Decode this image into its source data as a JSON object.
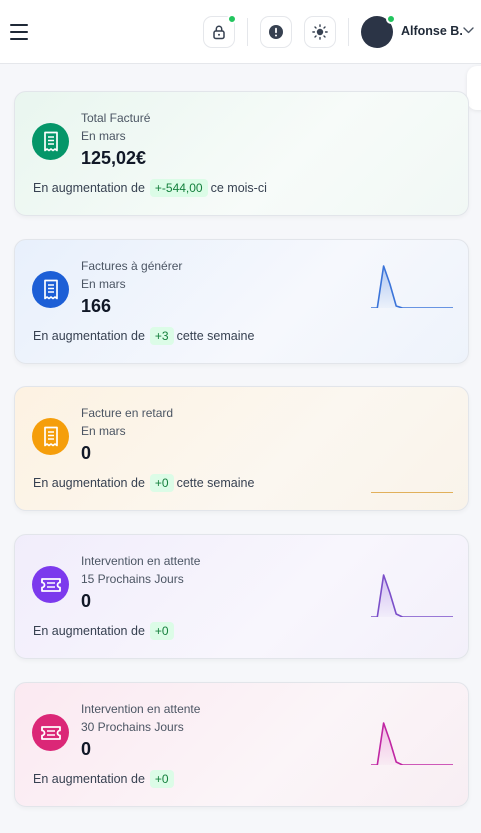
{
  "header": {
    "user_name": "Alfonse B.",
    "icons": [
      "menu-icon",
      "lock-icon",
      "alert-icon",
      "sun-icon",
      "avatar",
      "chevron-down-icon"
    ],
    "status_color": "#22c55e"
  },
  "cards": [
    {
      "title": "Total Facturé",
      "subtitle": "En mars",
      "value": "125,02€",
      "footer_prefix": "En augmentation de",
      "delta": "+-544,00",
      "footer_suffix": "ce mois-ci",
      "icon": "receipt-icon",
      "accent": "#059669",
      "sparkline": null
    },
    {
      "title": "Factures à générer",
      "subtitle": "En mars",
      "value": "166",
      "footer_prefix": "En augmentation de",
      "delta": "+3",
      "footer_suffix": "cette semaine",
      "icon": "receipt-icon",
      "accent": "#1d5fd6",
      "sparkline": {
        "color": "#3b74d9",
        "fill": "#a9c3f0",
        "values": [
          0,
          0,
          42,
          24,
          2,
          0,
          0,
          0,
          0,
          0,
          0,
          0,
          0,
          0
        ]
      }
    },
    {
      "title": "Facture en retard",
      "subtitle": "En mars",
      "value": "0",
      "footer_prefix": "En augmentation de",
      "delta": "+0",
      "footer_suffix": "cette semaine",
      "icon": "receipt-icon",
      "accent": "#f59e0b",
      "sparkline": {
        "color": "#d99a2b",
        "fill": "none",
        "values": [
          0,
          0,
          0,
          0,
          0,
          0,
          0,
          0,
          0,
          0,
          0,
          0,
          0,
          0
        ]
      }
    },
    {
      "title": "Intervention en attente",
      "subtitle": "15 Prochains Jours",
      "value": "0",
      "footer_prefix": "En augmentation de",
      "delta": "+0",
      "footer_suffix": "",
      "icon": "ticket-icon",
      "accent": "#7c3aed",
      "sparkline": {
        "color": "#7b4fc9",
        "fill": "#cdb8f0",
        "values": [
          0,
          0,
          28,
          16,
          2,
          0,
          0,
          0,
          0,
          0,
          0,
          0,
          0,
          0
        ]
      }
    },
    {
      "title": "Intervention en attente",
      "subtitle": "30 Prochains Jours",
      "value": "0",
      "footer_prefix": "En augmentation de",
      "delta": "+0",
      "footer_suffix": "",
      "icon": "ticket-icon",
      "accent": "#db2777",
      "sparkline": {
        "color": "#c026a3",
        "fill": "#f0b6e2",
        "values": [
          0,
          0,
          28,
          16,
          2,
          0,
          0,
          0,
          0,
          0,
          0,
          0,
          0,
          0
        ]
      }
    }
  ]
}
